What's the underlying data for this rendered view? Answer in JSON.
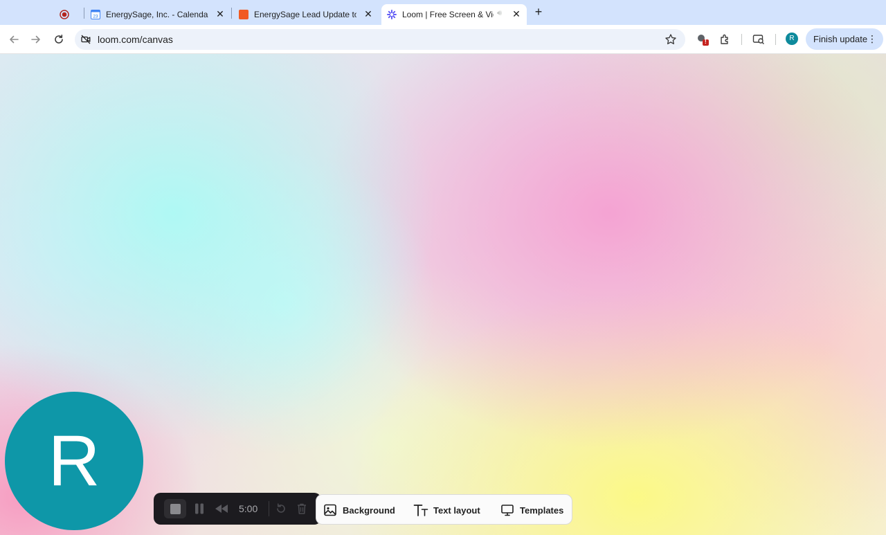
{
  "tabs": [
    {
      "title": "",
      "icon": "record-icon",
      "active": false
    },
    {
      "title": "EnergySage, Inc. - Calendar -",
      "icon": "google-calendar-icon",
      "active": false
    },
    {
      "title": "EnergySage Lead Update to I",
      "icon": "orange-square-icon",
      "active": false
    },
    {
      "title": "Loom | Free Screen & Vide",
      "icon": "loom-icon",
      "active": true
    }
  ],
  "toolbar": {
    "url": "loom.com/canvas",
    "profile_initial": "R",
    "finish_update_label": "Finish update",
    "extensions_badge": "!"
  },
  "canvas": {
    "camera_initial": "R"
  },
  "recording": {
    "timer": "5:00"
  },
  "options": {
    "background_label": "Background",
    "text_layout_label": "Text layout",
    "templates_label": "Templates"
  },
  "colors": {
    "tabstrip": "#d3e3fd",
    "avatar": "#0e97a8",
    "controls_bg": "#1c1b1f"
  }
}
